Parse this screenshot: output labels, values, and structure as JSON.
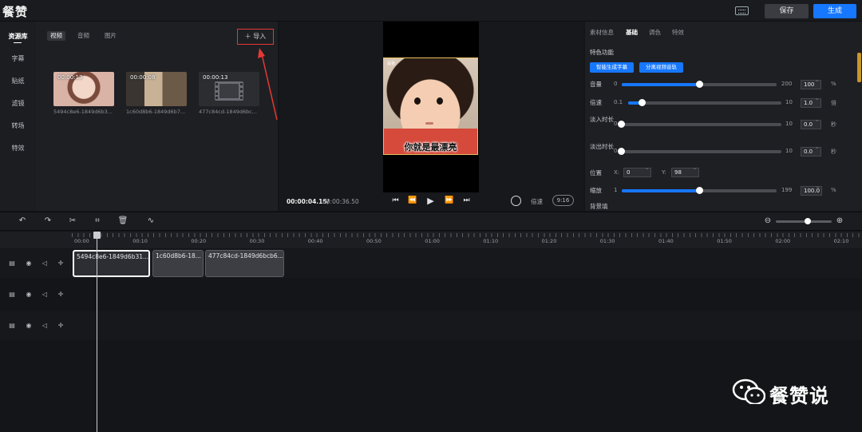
{
  "app": {
    "logo": "餐赞",
    "save_label": "保存",
    "generate_label": "生成"
  },
  "leftnav": {
    "items": [
      "资源库",
      "字幕",
      "贴纸",
      "滤镜",
      "转场",
      "特效"
    ]
  },
  "assets": {
    "tabs": [
      "视频",
      "音频",
      "图片"
    ],
    "import_label": "导入",
    "items": [
      {
        "duration": "00:00:13",
        "name": "5494c8e6-1849d6b3..."
      },
      {
        "duration": "00:00:08",
        "name": "1c60d8b6-1849d6b7..."
      },
      {
        "duration": "00:00:13",
        "name": "477c84cd-1849d6bc..."
      }
    ]
  },
  "preview": {
    "video_tag": "是我",
    "subtitle": "你就是最漂亮",
    "current_time": "00:00:04.15/",
    "total_time": "00:00:36.50",
    "speed_label": "倍速",
    "ratio_label": "9:16"
  },
  "props": {
    "tabs": [
      "素材信息",
      "基础",
      "调色",
      "特效"
    ],
    "section": "特色功能",
    "buttons": [
      "智能生成字幕",
      "分离视频音轨"
    ],
    "rows": [
      {
        "label": "音量",
        "min": "0",
        "max": "200",
        "value": "100",
        "unit": "%",
        "level": 0.5
      },
      {
        "label": "倍速",
        "min": "0.1",
        "max": "10",
        "value": "1.0",
        "unit": "倍",
        "level": 0.09
      },
      {
        "label": "淡入时长",
        "min": "0",
        "max": "10",
        "value": "0.0",
        "unit": "秒",
        "level": 0.0
      },
      {
        "label": "淡出时长",
        "min": "0",
        "max": "10",
        "value": "0.0",
        "unit": "秒",
        "level": 0.0
      },
      {
        "label": "缩放",
        "min": "1",
        "max": "199",
        "value": "100.0",
        "unit": "%",
        "level": 0.5
      }
    ],
    "position": {
      "label": "位置",
      "x_label": "X:",
      "x_value": "0",
      "y_label": "Y:",
      "y_value": "98"
    },
    "background_label": "背景填"
  },
  "timeline": {
    "ruler": [
      "00:00",
      "00:10",
      "00:20",
      "00:30",
      "00:40",
      "00:50",
      "01:00",
      "01:10",
      "01:20",
      "01:30",
      "01:40",
      "01:50",
      "02:00",
      "02:10"
    ],
    "clips": [
      "5494c8e6-1849d6b31...",
      "1c60d8b6-18...",
      "477c84cd-1849d6bcb6..."
    ]
  },
  "watermark": "餐赞说",
  "colors": {
    "accent": "#1677ff",
    "highlight": "#e53935"
  }
}
